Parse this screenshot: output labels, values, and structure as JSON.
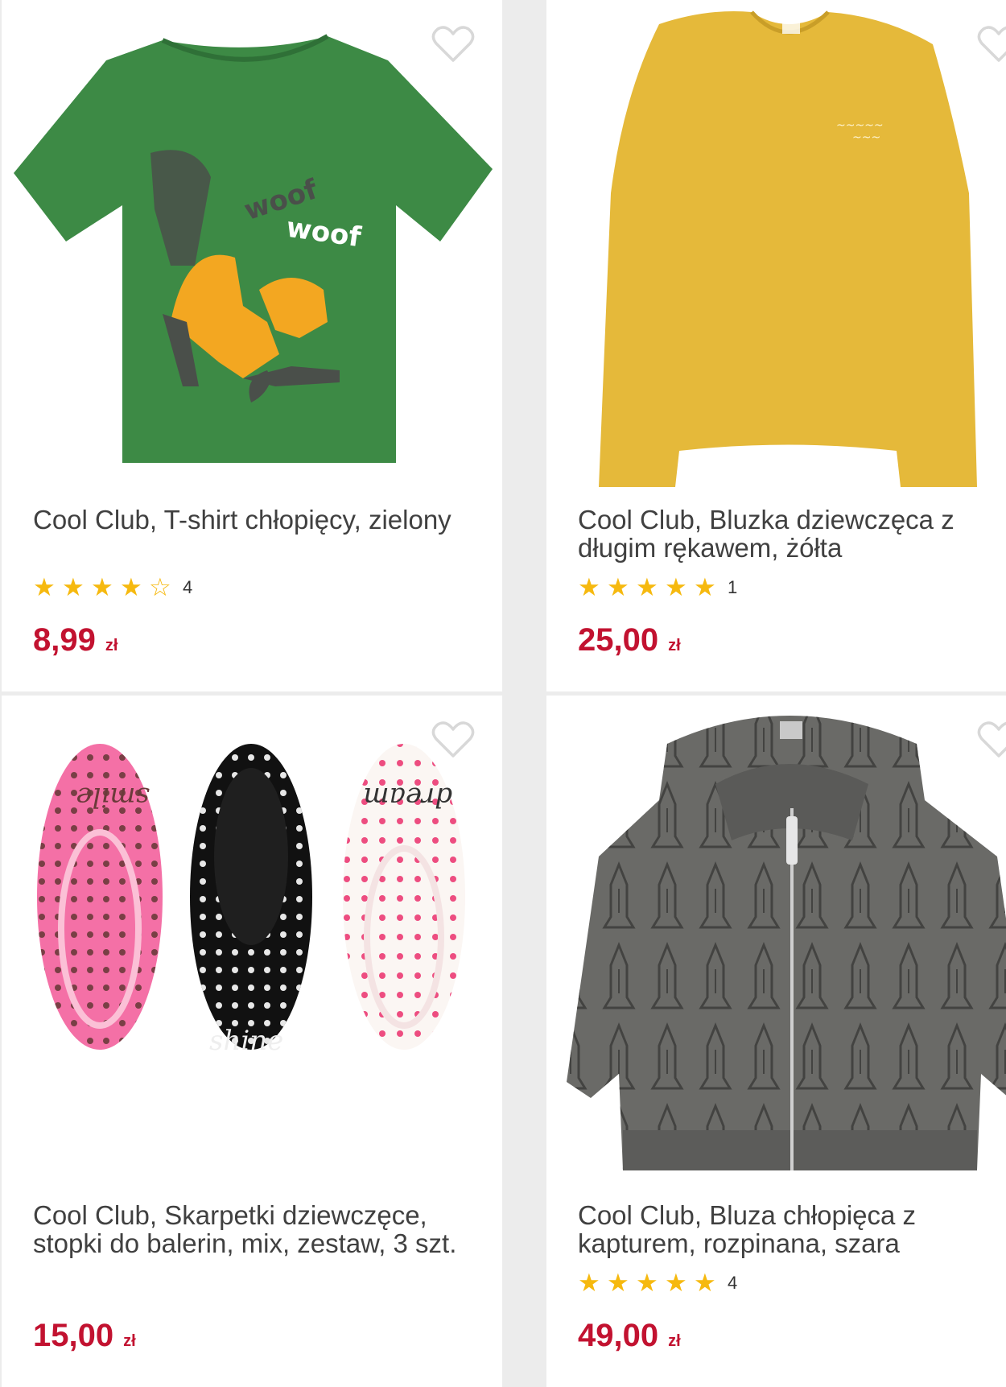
{
  "products": [
    {
      "title": "Cool Club, T-shirt chłopięcy, zielony",
      "rating_stars": 4,
      "rating_count": "4",
      "price": "8,99",
      "currency": "zł",
      "image_alt": "green-tshirt-dog-print"
    },
    {
      "title": "Cool Club, Bluzka dziewczęca z długim rękawem, żółta",
      "rating_stars": 5,
      "rating_count": "1",
      "price": "25,00",
      "currency": "zł",
      "image_alt": "yellow-long-sleeve-top"
    },
    {
      "title": "Cool Club, Skarpetki dziewczęce, stopki do balerin, mix, zestaw, 3 szt.",
      "rating_stars": null,
      "rating_count": "",
      "price": "15,00",
      "currency": "zł",
      "image_alt": "three-pairs-ballet-socks",
      "sock_texts": [
        "smile",
        "shine",
        "dream"
      ]
    },
    {
      "title": "Cool Club, Bluza chłopięca z kapturem, rozpinana, szara",
      "rating_stars": 5,
      "rating_count": "4",
      "price": "49,00",
      "currency": "zł",
      "image_alt": "grey-zip-hoodie-rocket-print"
    }
  ],
  "tshirt_print_text": [
    "woof",
    "woof"
  ],
  "colors": {
    "price": "#c21230",
    "star": "#f6b90f",
    "background": "#ececec",
    "card": "#ffffff"
  },
  "icons": {
    "wishlist": "heart-outline-icon",
    "star_full": "star-icon",
    "star_empty": "star-outline-icon"
  }
}
